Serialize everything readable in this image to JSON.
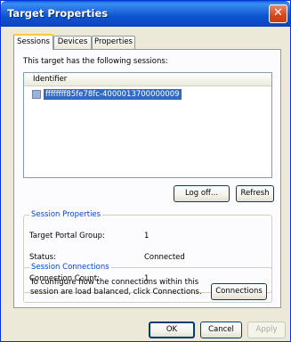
{
  "window": {
    "title": "Target Properties",
    "close_glyph": "✕"
  },
  "tabs": [
    {
      "label": "Sessions"
    },
    {
      "label": "Devices"
    },
    {
      "label": "Properties"
    }
  ],
  "sessions": {
    "intro": "This target has the following sessions:",
    "list_header": "Identifier",
    "items": [
      {
        "id": "ffffffff85fe78fc-4000013700000009",
        "checked": false
      }
    ],
    "logoff_label": "Log off...",
    "refresh_label": "Refresh"
  },
  "session_properties": {
    "title": "Session Properties",
    "rows": [
      {
        "label": "Target Portal Group:",
        "value": "1"
      },
      {
        "label": "Status:",
        "value": "Connected"
      },
      {
        "label": "Connection Count:",
        "value": "1"
      }
    ]
  },
  "session_connections": {
    "title": "Session Connections",
    "text": "To configure how the connections within this session are load balanced, click Connections.",
    "button_label": "Connections"
  },
  "footer": {
    "ok_label": "OK",
    "cancel_label": "Cancel",
    "apply_label": "Apply"
  },
  "colors": {
    "title_bar": "#0a5fd6",
    "selection": "#316ac5",
    "group_title": "#0046d5",
    "close_button": "#d6461d"
  }
}
